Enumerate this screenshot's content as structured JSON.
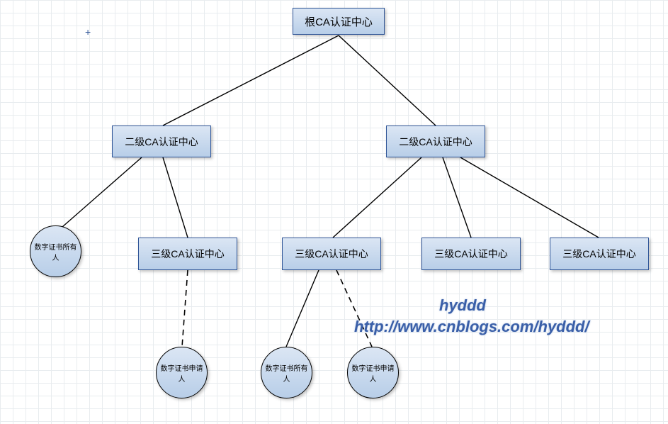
{
  "chart_data": {
    "type": "tree",
    "nodes": [
      {
        "id": "root",
        "shape": "rect",
        "label": "根CA认证中心"
      },
      {
        "id": "l2a",
        "shape": "rect",
        "label": "二级CA认证中心"
      },
      {
        "id": "l2b",
        "shape": "rect",
        "label": "二级CA认证中心"
      },
      {
        "id": "holder1",
        "shape": "circle",
        "label": "数字证书所有人"
      },
      {
        "id": "l3a",
        "shape": "rect",
        "label": "三级CA认证中心"
      },
      {
        "id": "l3b",
        "shape": "rect",
        "label": "三级CA认证中心"
      },
      {
        "id": "l3c",
        "shape": "rect",
        "label": "三级CA认证中心"
      },
      {
        "id": "l3d",
        "shape": "rect",
        "label": "三级CA认证中心"
      },
      {
        "id": "applicant1",
        "shape": "circle",
        "label": "数字证书申请人"
      },
      {
        "id": "holder2",
        "shape": "circle",
        "label": "数字证书所有人"
      },
      {
        "id": "applicant2",
        "shape": "circle",
        "label": "数字证书申请人"
      }
    ],
    "edges": [
      {
        "from": "root",
        "to": "l2a",
        "style": "solid"
      },
      {
        "from": "root",
        "to": "l2b",
        "style": "solid"
      },
      {
        "from": "l2a",
        "to": "holder1",
        "style": "solid"
      },
      {
        "from": "l2a",
        "to": "l3a",
        "style": "solid"
      },
      {
        "from": "l2b",
        "to": "l3b",
        "style": "solid"
      },
      {
        "from": "l2b",
        "to": "l3c",
        "style": "solid"
      },
      {
        "from": "l2b",
        "to": "l3d",
        "style": "solid"
      },
      {
        "from": "l3a",
        "to": "applicant1",
        "style": "dashed"
      },
      {
        "from": "l3b",
        "to": "holder2",
        "style": "solid"
      },
      {
        "from": "l3b",
        "to": "applicant2",
        "style": "dashed"
      }
    ]
  },
  "nodes": {
    "root": "根CA认证中心",
    "l2a": "二级CA认证中心",
    "l2b": "二级CA认证中心",
    "holder1": "数字证书所有人",
    "l3a": "三级CA认证中心",
    "l3b": "三级CA认证中心",
    "l3c": "三级CA认证中心",
    "l3d": "三级CA认证中心",
    "applicant1": "数字证书申请人",
    "holder2": "数字证书所有人",
    "applicant2": "数字证书申请人"
  },
  "watermark": {
    "line1": "hyddd",
    "line2": "http://www.cnblogs.com/hyddd/"
  }
}
